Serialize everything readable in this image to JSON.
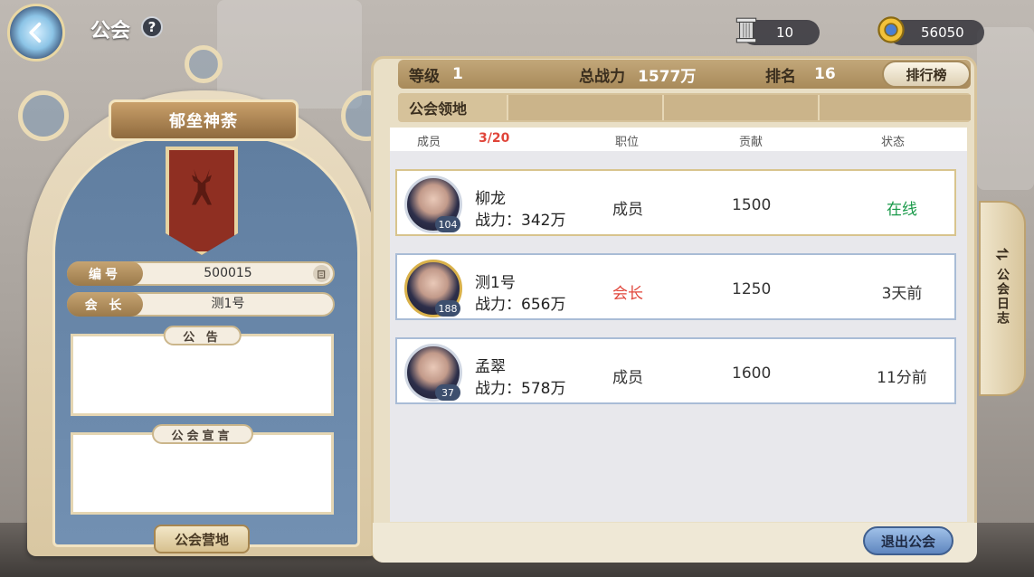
{
  "header": {
    "title": "公会",
    "help": "?"
  },
  "resources": [
    {
      "icon": "pillar-icon",
      "value": "10"
    },
    {
      "icon": "gold-coin-icon",
      "value": "56050"
    }
  ],
  "guild": {
    "name": "郁垒神荼",
    "id_label": "编号",
    "id_value": "500015",
    "leader_label": "会 长",
    "leader_value": "测1号",
    "notice_label": "公 告",
    "declaration_label": "公会宣言",
    "camp_button": "公会营地"
  },
  "stats": {
    "level_label": "等级",
    "level_value": "1",
    "power_label": "总战力",
    "power_value": "1577万",
    "rank_label": "排名",
    "rank_value": "16",
    "leaderboard_button": "排行榜",
    "territory_label": "公会领地"
  },
  "list_header": {
    "member": "成员",
    "count": "3/20",
    "position": "职位",
    "contribution": "贡献",
    "status": "状态"
  },
  "members": [
    {
      "name": "柳龙",
      "power": "战力：342万",
      "level": "104",
      "role": "成员",
      "contribution": "1500",
      "status": "在线"
    },
    {
      "name": "测1号",
      "power": "战力：656万",
      "level": "188",
      "role": "会长",
      "contribution": "1250",
      "status": "3天前"
    },
    {
      "name": "孟翠",
      "power": "战力：578万",
      "level": "37",
      "role": "成员",
      "contribution": "1600",
      "status": "11分前"
    }
  ],
  "quit_button": "退出公会",
  "log_tab": "公会日志",
  "colors": {
    "online": "#1a9a4a",
    "leader": "#e0453a",
    "row_border_selected": "#d8c48d",
    "row_border": "#a9bcd6"
  }
}
